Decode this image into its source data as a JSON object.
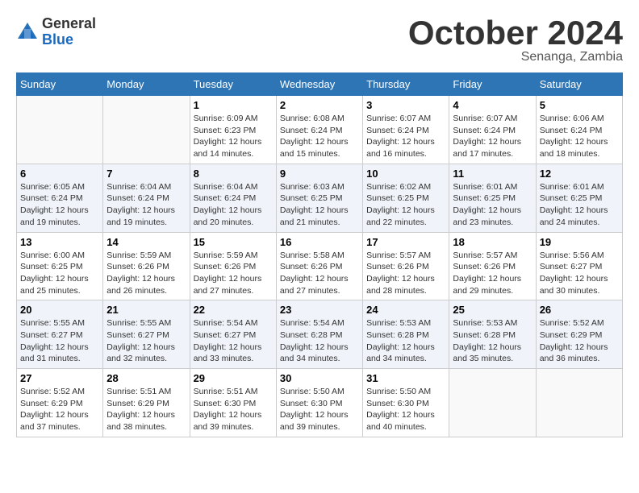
{
  "header": {
    "logo_line1": "General",
    "logo_line2": "Blue",
    "month_title": "October 2024",
    "location": "Senanga, Zambia"
  },
  "weekdays": [
    "Sunday",
    "Monday",
    "Tuesday",
    "Wednesday",
    "Thursday",
    "Friday",
    "Saturday"
  ],
  "weeks": [
    [
      {
        "day": "",
        "info": ""
      },
      {
        "day": "",
        "info": ""
      },
      {
        "day": "1",
        "info": "Sunrise: 6:09 AM\nSunset: 6:23 PM\nDaylight: 12 hours\nand 14 minutes."
      },
      {
        "day": "2",
        "info": "Sunrise: 6:08 AM\nSunset: 6:24 PM\nDaylight: 12 hours\nand 15 minutes."
      },
      {
        "day": "3",
        "info": "Sunrise: 6:07 AM\nSunset: 6:24 PM\nDaylight: 12 hours\nand 16 minutes."
      },
      {
        "day": "4",
        "info": "Sunrise: 6:07 AM\nSunset: 6:24 PM\nDaylight: 12 hours\nand 17 minutes."
      },
      {
        "day": "5",
        "info": "Sunrise: 6:06 AM\nSunset: 6:24 PM\nDaylight: 12 hours\nand 18 minutes."
      }
    ],
    [
      {
        "day": "6",
        "info": "Sunrise: 6:05 AM\nSunset: 6:24 PM\nDaylight: 12 hours\nand 19 minutes."
      },
      {
        "day": "7",
        "info": "Sunrise: 6:04 AM\nSunset: 6:24 PM\nDaylight: 12 hours\nand 19 minutes."
      },
      {
        "day": "8",
        "info": "Sunrise: 6:04 AM\nSunset: 6:24 PM\nDaylight: 12 hours\nand 20 minutes."
      },
      {
        "day": "9",
        "info": "Sunrise: 6:03 AM\nSunset: 6:25 PM\nDaylight: 12 hours\nand 21 minutes."
      },
      {
        "day": "10",
        "info": "Sunrise: 6:02 AM\nSunset: 6:25 PM\nDaylight: 12 hours\nand 22 minutes."
      },
      {
        "day": "11",
        "info": "Sunrise: 6:01 AM\nSunset: 6:25 PM\nDaylight: 12 hours\nand 23 minutes."
      },
      {
        "day": "12",
        "info": "Sunrise: 6:01 AM\nSunset: 6:25 PM\nDaylight: 12 hours\nand 24 minutes."
      }
    ],
    [
      {
        "day": "13",
        "info": "Sunrise: 6:00 AM\nSunset: 6:25 PM\nDaylight: 12 hours\nand 25 minutes."
      },
      {
        "day": "14",
        "info": "Sunrise: 5:59 AM\nSunset: 6:26 PM\nDaylight: 12 hours\nand 26 minutes."
      },
      {
        "day": "15",
        "info": "Sunrise: 5:59 AM\nSunset: 6:26 PM\nDaylight: 12 hours\nand 27 minutes."
      },
      {
        "day": "16",
        "info": "Sunrise: 5:58 AM\nSunset: 6:26 PM\nDaylight: 12 hours\nand 27 minutes."
      },
      {
        "day": "17",
        "info": "Sunrise: 5:57 AM\nSunset: 6:26 PM\nDaylight: 12 hours\nand 28 minutes."
      },
      {
        "day": "18",
        "info": "Sunrise: 5:57 AM\nSunset: 6:26 PM\nDaylight: 12 hours\nand 29 minutes."
      },
      {
        "day": "19",
        "info": "Sunrise: 5:56 AM\nSunset: 6:27 PM\nDaylight: 12 hours\nand 30 minutes."
      }
    ],
    [
      {
        "day": "20",
        "info": "Sunrise: 5:55 AM\nSunset: 6:27 PM\nDaylight: 12 hours\nand 31 minutes."
      },
      {
        "day": "21",
        "info": "Sunrise: 5:55 AM\nSunset: 6:27 PM\nDaylight: 12 hours\nand 32 minutes."
      },
      {
        "day": "22",
        "info": "Sunrise: 5:54 AM\nSunset: 6:27 PM\nDaylight: 12 hours\nand 33 minutes."
      },
      {
        "day": "23",
        "info": "Sunrise: 5:54 AM\nSunset: 6:28 PM\nDaylight: 12 hours\nand 34 minutes."
      },
      {
        "day": "24",
        "info": "Sunrise: 5:53 AM\nSunset: 6:28 PM\nDaylight: 12 hours\nand 34 minutes."
      },
      {
        "day": "25",
        "info": "Sunrise: 5:53 AM\nSunset: 6:28 PM\nDaylight: 12 hours\nand 35 minutes."
      },
      {
        "day": "26",
        "info": "Sunrise: 5:52 AM\nSunset: 6:29 PM\nDaylight: 12 hours\nand 36 minutes."
      }
    ],
    [
      {
        "day": "27",
        "info": "Sunrise: 5:52 AM\nSunset: 6:29 PM\nDaylight: 12 hours\nand 37 minutes."
      },
      {
        "day": "28",
        "info": "Sunrise: 5:51 AM\nSunset: 6:29 PM\nDaylight: 12 hours\nand 38 minutes."
      },
      {
        "day": "29",
        "info": "Sunrise: 5:51 AM\nSunset: 6:30 PM\nDaylight: 12 hours\nand 39 minutes."
      },
      {
        "day": "30",
        "info": "Sunrise: 5:50 AM\nSunset: 6:30 PM\nDaylight: 12 hours\nand 39 minutes."
      },
      {
        "day": "31",
        "info": "Sunrise: 5:50 AM\nSunset: 6:30 PM\nDaylight: 12 hours\nand 40 minutes."
      },
      {
        "day": "",
        "info": ""
      },
      {
        "day": "",
        "info": ""
      }
    ]
  ]
}
